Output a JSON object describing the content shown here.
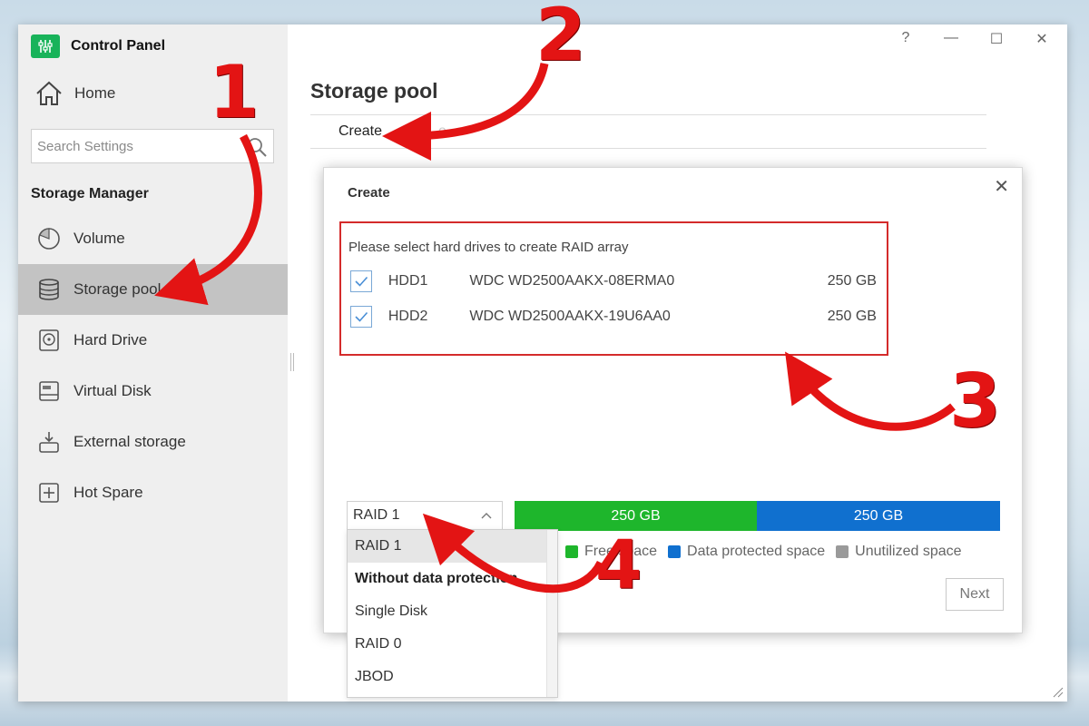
{
  "window": {
    "app_title": "Control Panel",
    "controls": [
      "?",
      "—",
      "☐",
      "✕"
    ]
  },
  "sidebar": {
    "home_label": "Home",
    "search_placeholder": "Search Settings",
    "section_title": "Storage Manager",
    "items": [
      {
        "label": "Volume",
        "icon": "volume-pie-icon",
        "active": false
      },
      {
        "label": "Storage pool",
        "icon": "database-stack-icon",
        "active": true
      },
      {
        "label": "Hard Drive",
        "icon": "hard-drive-icon",
        "active": false
      },
      {
        "label": "Virtual Disk",
        "icon": "virtual-disk-icon",
        "active": false
      },
      {
        "label": "External storage",
        "icon": "external-storage-icon",
        "active": false
      },
      {
        "label": "Hot Spare",
        "icon": "hot-spare-icon",
        "active": false
      }
    ]
  },
  "main": {
    "title": "Storage pool",
    "tabs": [
      {
        "label": "Create"
      },
      {
        "label": "e"
      }
    ]
  },
  "dialog": {
    "title": "Create",
    "close": "✕",
    "prompt": "Please select hard drives to create RAID array",
    "drives": [
      {
        "name": "HDD1",
        "model": "WDC WD2500AAKX-08ERMA0",
        "size": "250 GB",
        "checked": true
      },
      {
        "name": "HDD2",
        "model": "WDC WD2500AAKX-19U6AA0",
        "size": "250 GB",
        "checked": true
      }
    ],
    "raid_select": {
      "value": "RAID 1",
      "options": [
        {
          "label": "RAID 1",
          "kind": "selected"
        },
        {
          "label": "Without data protection",
          "kind": "group"
        },
        {
          "label": "Single Disk",
          "kind": "option"
        },
        {
          "label": "RAID 0",
          "kind": "option"
        },
        {
          "label": "JBOD",
          "kind": "option"
        }
      ]
    },
    "capacity": {
      "free_label": "250 GB",
      "protected_label": "250 GB",
      "colors": {
        "free": "#1eb62c",
        "protected": "#1070cf",
        "unutilized": "#9a9a9a"
      }
    },
    "legend": {
      "free": "Free space",
      "protected": "Data protected space",
      "unutilized": "Unutilized space"
    },
    "next_label": "Next"
  },
  "annotations": {
    "step1": "1",
    "step2": "2",
    "step3": "3",
    "step4": "4",
    "accent": "#e31414"
  }
}
